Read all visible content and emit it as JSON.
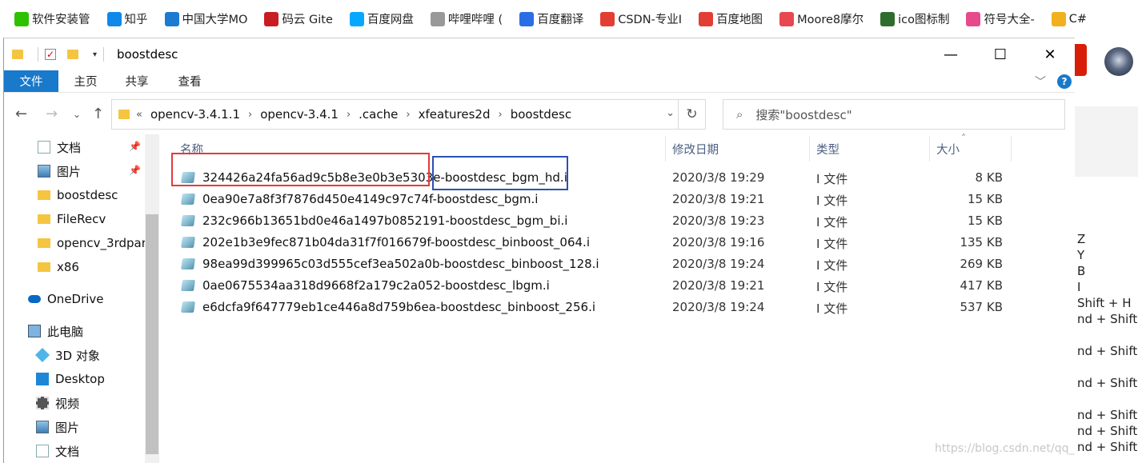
{
  "bookmarks": [
    {
      "icon": "wechat-icon",
      "label": "软件安装管",
      "color": "#2dc100"
    },
    {
      "icon": "zhihu-icon",
      "label": "知乎",
      "color": "#0f88eb"
    },
    {
      "icon": "mooc-icon",
      "label": "中国大学MO",
      "color": "#1a7bd0"
    },
    {
      "icon": "gitee-icon",
      "label": "码云 Gite",
      "color": "#c71d23"
    },
    {
      "icon": "baidu-pan-icon",
      "label": "百度网盘",
      "color": "#06a7ff"
    },
    {
      "icon": "document-icon",
      "label": "哔哩哔哩 (",
      "color": "#999999"
    },
    {
      "icon": "baidu-translate-icon",
      "label": "百度翻译",
      "color": "#2b6de5"
    },
    {
      "icon": "csdn-icon",
      "label": "CSDN-专业I",
      "color": "#e33e33"
    },
    {
      "icon": "map-pin-icon",
      "label": "百度地图",
      "color": "#e33e33"
    },
    {
      "icon": "moore-icon",
      "label": "Moore8摩尔",
      "color": "#e8484f"
    },
    {
      "icon": "bit-icon",
      "label": "ico图标制",
      "color": "#2f6d2f"
    },
    {
      "icon": "smiley-icon",
      "label": "符号大全-",
      "color": "#e64a8b"
    },
    {
      "icon": "trophy-icon",
      "label": "C#",
      "color": "#f2b01e"
    }
  ],
  "window": {
    "title": "boostdesc",
    "ribbon_tabs": [
      "文件",
      "主页",
      "共享",
      "查看"
    ]
  },
  "address": {
    "overflow": "«",
    "crumbs": [
      "opencv-3.4.1.1",
      "opencv-3.4.1",
      ".cache",
      "xfeatures2d",
      "boostdesc"
    ],
    "search_placeholder": "搜索\"boostdesc\""
  },
  "sidebar": [
    {
      "label": "文档",
      "icon": "documents-icon",
      "pinned": true
    },
    {
      "label": "图片",
      "icon": "pictures-icon",
      "pinned": true
    },
    {
      "label": "boostdesc",
      "icon": "folder-icon"
    },
    {
      "label": "FileRecv",
      "icon": "folder-icon"
    },
    {
      "label": "opencv_3rdpar",
      "icon": "folder-icon"
    },
    {
      "label": "x86",
      "icon": "folder-icon"
    },
    {
      "label": "OneDrive",
      "icon": "onedrive-icon"
    },
    {
      "label": "此电脑",
      "icon": "this-pc-icon"
    },
    {
      "label": "3D 对象",
      "icon": "3d-objects-icon"
    },
    {
      "label": "Desktop",
      "icon": "desktop-icon"
    },
    {
      "label": "视频",
      "icon": "videos-icon"
    },
    {
      "label": "图片",
      "icon": "pictures-icon"
    },
    {
      "label": "文档",
      "icon": "documents-icon"
    }
  ],
  "columns": {
    "name": "名称",
    "date": "修改日期",
    "type": "类型",
    "size": "大小"
  },
  "files": [
    {
      "name": "324426a24fa56ad9c5b8e3e0b3e5303e-boostdesc_bgm_hd.i",
      "date": "2020/3/8 19:29",
      "type": "I 文件",
      "size": "8 KB"
    },
    {
      "name": "0ea90e7a8f3f7876d450e4149c97c74f-boostdesc_bgm.i",
      "date": "2020/3/8 19:21",
      "type": "I 文件",
      "size": "15 KB"
    },
    {
      "name": "232c966b13651bd0e46a1497b0852191-boostdesc_bgm_bi.i",
      "date": "2020/3/8 19:23",
      "type": "I 文件",
      "size": "15 KB"
    },
    {
      "name": "202e1b3e9fec871b04da31f7f016679f-boostdesc_binboost_064.i",
      "date": "2020/3/8 19:16",
      "type": "I 文件",
      "size": "135 KB"
    },
    {
      "name": "98ea99d399965c03d555cef3ea502a0b-boostdesc_binboost_128.i",
      "date": "2020/3/8 19:24",
      "type": "I 文件",
      "size": "269 KB"
    },
    {
      "name": "0ae0675534aa318d9668f2a179c2a052-boostdesc_lbgm.i",
      "date": "2020/3/8 19:21",
      "type": "I 文件",
      "size": "417 KB"
    },
    {
      "name": "e6dcfa9f647779eb1ce446a8d759b6ea-boostdesc_binboost_256.i",
      "date": "2020/3/8 19:24",
      "type": "I 文件",
      "size": "537 KB"
    }
  ],
  "background_snippets": [
    "Z",
    "Y",
    "B",
    "I",
    "Shift + H",
    "nd + Shift +",
    "nd + Shift +",
    "nd + Shift +",
    "nd + Shift +",
    "nd + Shift +",
    "nd + Shift +"
  ],
  "watermark": "https://blog.csdn.net/qq_"
}
